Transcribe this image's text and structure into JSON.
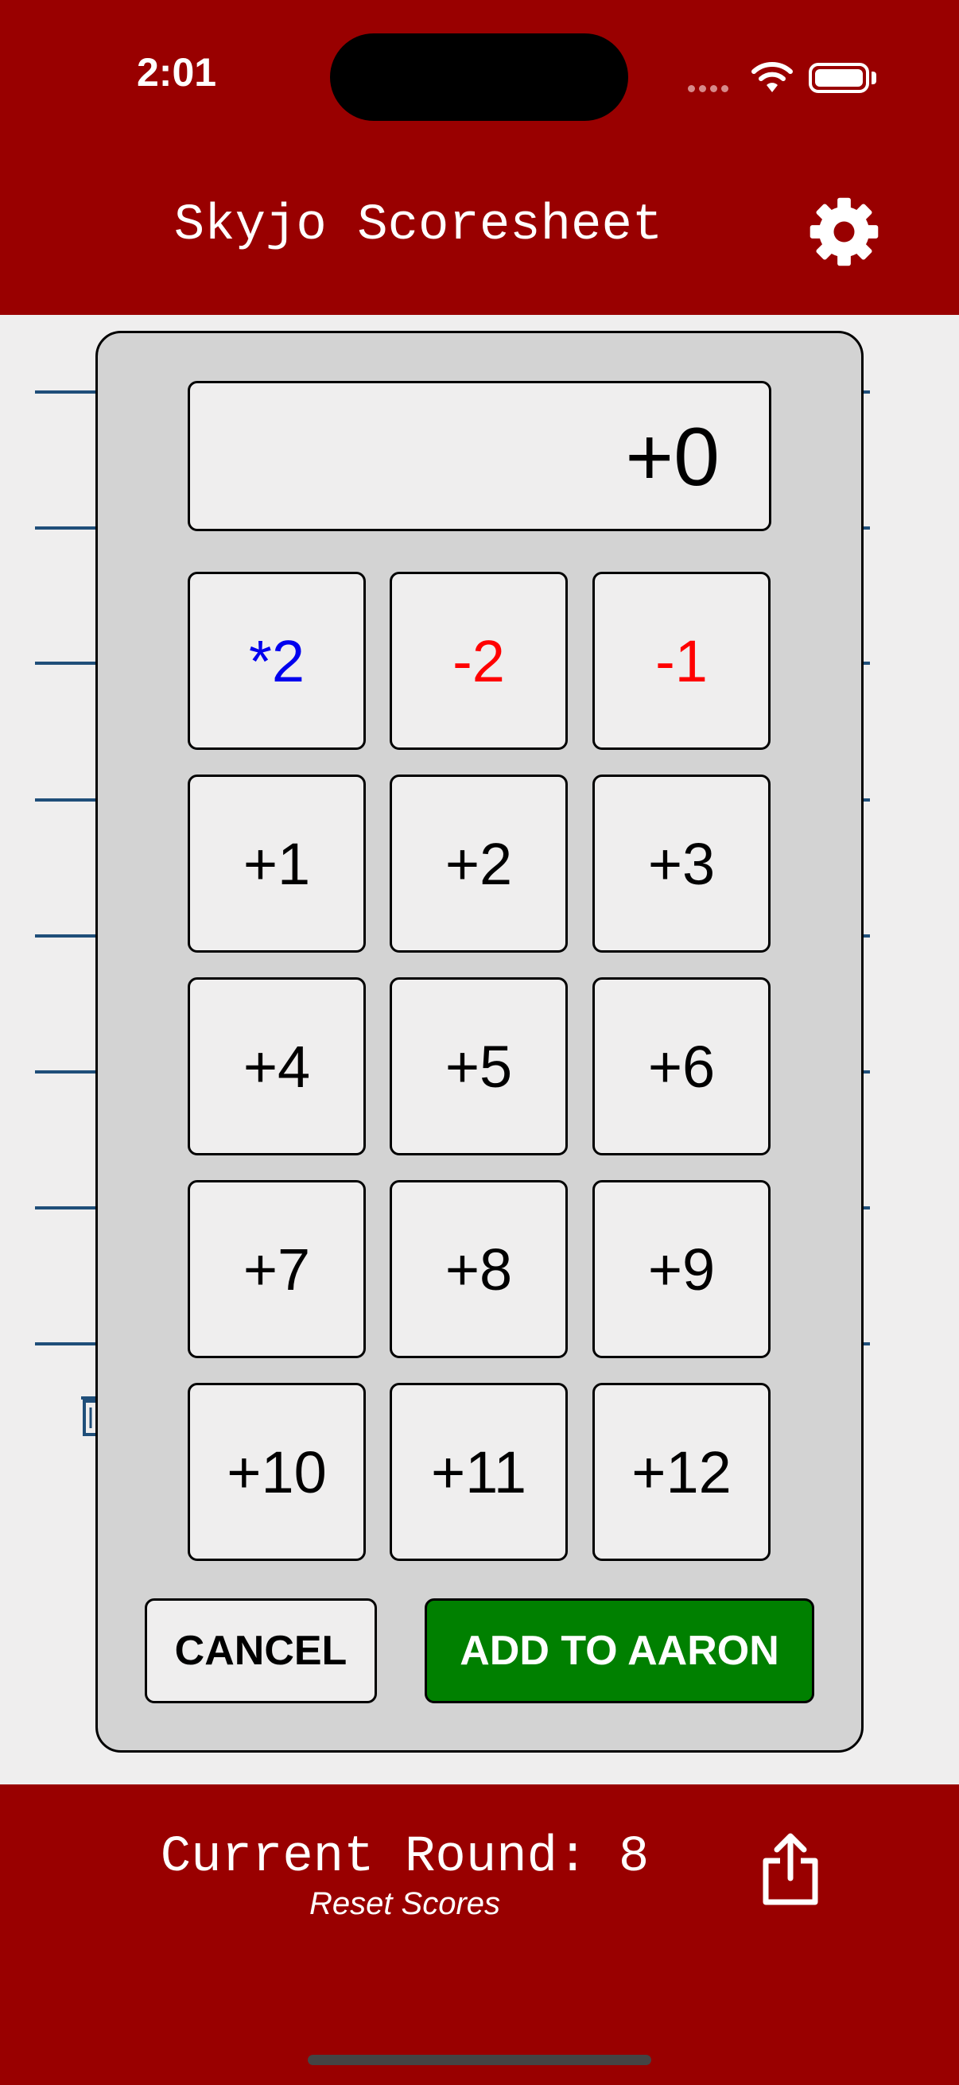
{
  "status": {
    "time": "2:01"
  },
  "header": {
    "title": "Skyjo Scoresheet",
    "settings_icon": "gear-icon"
  },
  "keypad": {
    "display": "+0",
    "keys": [
      {
        "label": "*2",
        "color": "#0000ee"
      },
      {
        "label": "-2",
        "color": "#ff0000"
      },
      {
        "label": "-1",
        "color": "#ff0000"
      },
      {
        "label": "+1"
      },
      {
        "label": "+2"
      },
      {
        "label": "+3"
      },
      {
        "label": "+4"
      },
      {
        "label": "+5"
      },
      {
        "label": "+6"
      },
      {
        "label": "+7"
      },
      {
        "label": "+8"
      },
      {
        "label": "+9"
      },
      {
        "label": "+10"
      },
      {
        "label": "+11"
      },
      {
        "label": "+12"
      }
    ],
    "cancel_label": "CANCEL",
    "add_label": "ADD TO AARON"
  },
  "footer": {
    "round_label": "Current Round: 8",
    "reset_label": "Reset Scores",
    "share_icon": "share-icon"
  },
  "colors": {
    "brand": "#990000",
    "confirm": "#008000",
    "line": "#1f4e79"
  }
}
